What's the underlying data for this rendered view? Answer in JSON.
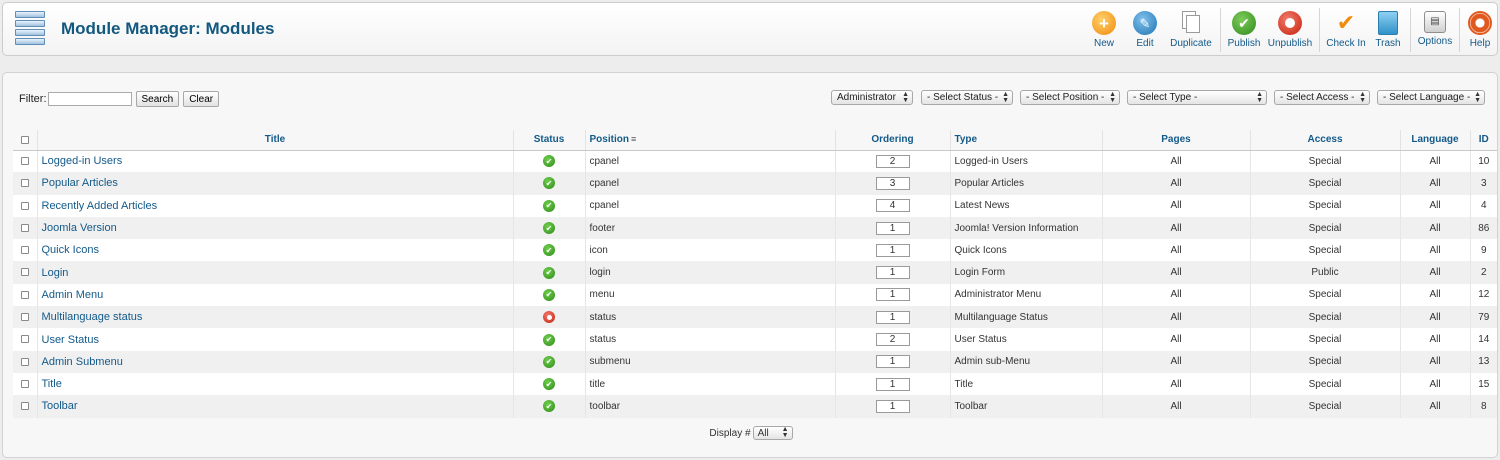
{
  "header": {
    "title": "Module Manager: Modules",
    "toolbar": [
      {
        "name": "new-button",
        "icon": "plus-icon",
        "label": "New"
      },
      {
        "name": "edit-button",
        "icon": "pencil-icon",
        "label": "Edit"
      },
      {
        "name": "duplicate-button",
        "icon": "duplicate-icon",
        "label": "Duplicate"
      },
      {
        "name": "publish-button",
        "icon": "check-circle-icon",
        "label": "Publish"
      },
      {
        "name": "unpublish-button",
        "icon": "unpublish-icon",
        "label": "Unpublish"
      },
      {
        "name": "check-in-button",
        "icon": "checkmark-icon",
        "label": "Check In"
      },
      {
        "name": "trash-button",
        "icon": "trash-icon",
        "label": "Trash"
      },
      {
        "name": "options-button",
        "icon": "options-icon",
        "label": "Options"
      },
      {
        "name": "help-button",
        "icon": "lifebuoy-icon",
        "label": "Help"
      }
    ]
  },
  "filter": {
    "label": "Filter:",
    "value": "",
    "search_label": "Search",
    "clear_label": "Clear"
  },
  "selects": {
    "client": "Administrator",
    "status": "- Select Status -",
    "position": "- Select Position -",
    "type": "- Select Type -",
    "access": "- Select Access -",
    "language": "- Select Language -"
  },
  "table": {
    "columns": {
      "title": "Title",
      "status": "Status",
      "position": "Position",
      "ordering": "Ordering",
      "type": "Type",
      "pages": "Pages",
      "access": "Access",
      "language": "Language",
      "id": "ID"
    },
    "rows": [
      {
        "title": "Logged-in Users",
        "published": true,
        "position": "cpanel",
        "ordering": "2",
        "type": "Logged-in Users",
        "pages": "All",
        "access": "Special",
        "language": "All",
        "id": "10"
      },
      {
        "title": "Popular Articles",
        "published": true,
        "position": "cpanel",
        "ordering": "3",
        "type": "Popular Articles",
        "pages": "All",
        "access": "Special",
        "language": "All",
        "id": "3"
      },
      {
        "title": "Recently Added Articles",
        "published": true,
        "position": "cpanel",
        "ordering": "4",
        "type": "Latest News",
        "pages": "All",
        "access": "Special",
        "language": "All",
        "id": "4"
      },
      {
        "title": "Joomla Version",
        "published": true,
        "position": "footer",
        "ordering": "1",
        "type": "Joomla! Version Information",
        "pages": "All",
        "access": "Special",
        "language": "All",
        "id": "86"
      },
      {
        "title": "Quick Icons",
        "published": true,
        "position": "icon",
        "ordering": "1",
        "type": "Quick Icons",
        "pages": "All",
        "access": "Special",
        "language": "All",
        "id": "9"
      },
      {
        "title": "Login",
        "published": true,
        "position": "login",
        "ordering": "1",
        "type": "Login Form",
        "pages": "All",
        "access": "Public",
        "language": "All",
        "id": "2"
      },
      {
        "title": "Admin Menu",
        "published": true,
        "position": "menu",
        "ordering": "1",
        "type": "Administrator Menu",
        "pages": "All",
        "access": "Special",
        "language": "All",
        "id": "12"
      },
      {
        "title": "Multilanguage status",
        "published": false,
        "position": "status",
        "ordering": "1",
        "type": "Multilanguage Status",
        "pages": "All",
        "access": "Special",
        "language": "All",
        "id": "79"
      },
      {
        "title": "User Status",
        "published": true,
        "position": "status",
        "ordering": "2",
        "type": "User Status",
        "pages": "All",
        "access": "Special",
        "language": "All",
        "id": "14"
      },
      {
        "title": "Admin Submenu",
        "published": true,
        "position": "submenu",
        "ordering": "1",
        "type": "Admin sub-Menu",
        "pages": "All",
        "access": "Special",
        "language": "All",
        "id": "13"
      },
      {
        "title": "Title",
        "published": true,
        "position": "title",
        "ordering": "1",
        "type": "Title",
        "pages": "All",
        "access": "Special",
        "language": "All",
        "id": "15"
      },
      {
        "title": "Toolbar",
        "published": true,
        "position": "toolbar",
        "ordering": "1",
        "type": "Toolbar",
        "pages": "All",
        "access": "Special",
        "language": "All",
        "id": "8"
      }
    ]
  },
  "footer": {
    "display_label": "Display #",
    "display_value": "All"
  }
}
